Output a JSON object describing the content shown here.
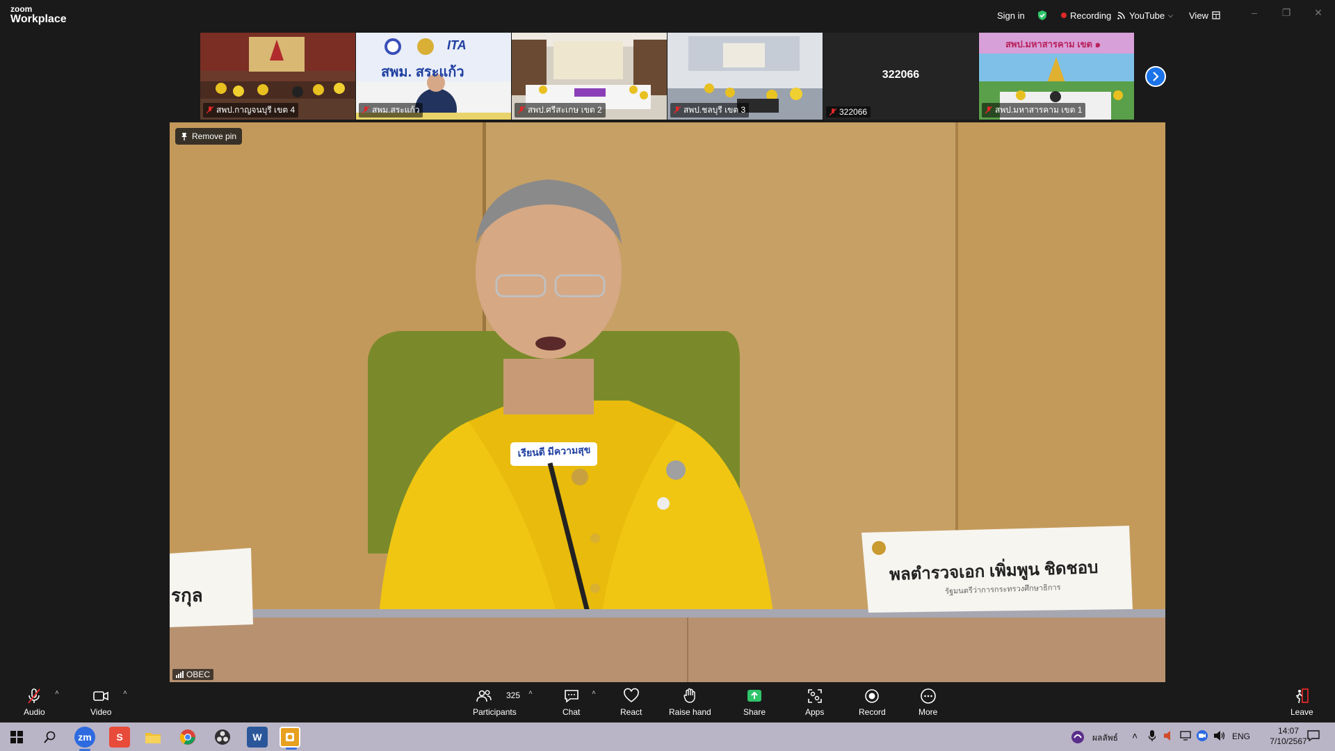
{
  "app": {
    "logo_top": "zoom",
    "logo_bottom": "Workplace"
  },
  "titlebar": {
    "sign_in": "Sign in",
    "recording": "Recording",
    "youtube": "YouTube",
    "view": "View"
  },
  "thumbnails": [
    {
      "label": "สพป.กาญจนบุรี เขต 4"
    },
    {
      "label": "สพม.สระแก้ว",
      "sign_text": "สพม. สระแก้ว",
      "sign_brand": "ITA"
    },
    {
      "label": "สพป.ศรีสะเกษ เขต 2"
    },
    {
      "label": "สพป.ชลบุรี เขต 3"
    },
    {
      "label": "322066",
      "center_text": "322066"
    },
    {
      "label": "สพป.มหาสารคาม เขต 1",
      "banner_text": "สพป.มหาสารคาม เขต ๑"
    }
  ],
  "main": {
    "remove_pin": "Remove pin",
    "speaker": "OBEC",
    "nameplate_right": "พลตำรวจเอก เพิ่มพูน ชิดชอบ",
    "nameplate_right_sub": "รัฐมนตรีว่าการกระทรวงศึกษาธิการ",
    "nameplate_left": "รกุล",
    "mic_badge": "เรียนดี มีความสุข"
  },
  "toolbar": {
    "audio": "Audio",
    "video": "Video",
    "participants": "Participants",
    "participants_count": "325",
    "chat": "Chat",
    "react": "React",
    "raise_hand": "Raise hand",
    "share": "Share",
    "apps": "Apps",
    "record": "Record",
    "more": "More",
    "leave": "Leave"
  },
  "taskbar": {
    "weather": "ผลลัพธ์",
    "lang": "ENG",
    "time": "14:07",
    "date": "7/10/2567"
  },
  "colors": {
    "share_green": "#2fc46a",
    "accent_blue": "#1a73e8",
    "recording_red": "#e02828",
    "mic_off_red": "#e02828"
  }
}
